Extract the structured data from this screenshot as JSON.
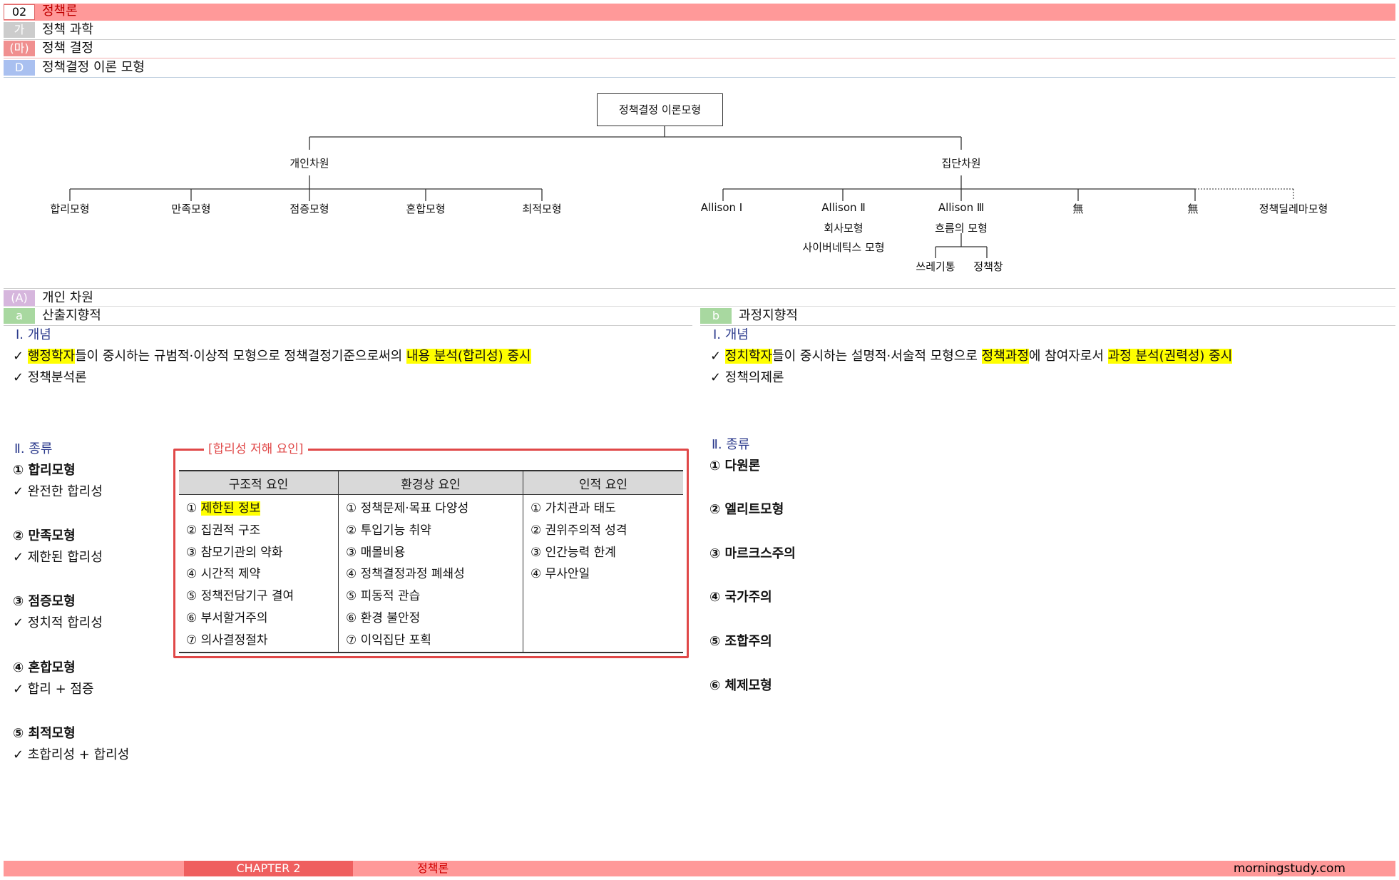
{
  "header": {
    "row1": {
      "num": "02",
      "title": "정책론"
    },
    "row2": {
      "tag": "가",
      "title": "정책 과학"
    },
    "row3": {
      "tag": "(마)",
      "title": "정책 결정"
    },
    "row4": {
      "tag": "D",
      "title": "정책결정 이론 모형"
    }
  },
  "tree": {
    "root": "정책결정 이론모형",
    "individual": "개인차원",
    "group": "집단차원",
    "ind_leaves": [
      "합리모형",
      "만족모형",
      "점증모형",
      "혼합모형",
      "최적모형"
    ],
    "allison1": "Allison Ⅰ",
    "allison2": "Allison Ⅱ",
    "allison2_sub1": "회사모형",
    "allison2_sub2": "사이버네틱스 모형",
    "allison3": "Allison Ⅲ",
    "allison3_sub": "흐름의 모형",
    "trash": "쓰레기통",
    "window": "정책창",
    "none1": "無",
    "none2": "無",
    "dilemma": "정책딜레마모형"
  },
  "sectionA": {
    "tag": "(A)",
    "title": "개인 차원"
  },
  "left": {
    "sub_tag": "a",
    "sub_title": "산출지향적",
    "concept_heading": "Ⅰ. 개념",
    "concept_l1": {
      "check": "✓",
      "hl1": "행정학자",
      "mid": "들이 중시하는 규범적·이상적 모형으로 정책결정기준으로써의 ",
      "hl2": "내용 분석(합리성) 중시"
    },
    "concept_l2": "✓ 정책분석론",
    "kinds_heading": "Ⅱ. 종류",
    "kinds": [
      {
        "title": "① 합리모형",
        "desc": "✓ 완전한 합리성"
      },
      {
        "title": "② 만족모형",
        "desc": "✓ 제한된 합리성"
      },
      {
        "title": "③ 점증모형",
        "desc": "✓ 정치적 합리성"
      },
      {
        "title": "④ 혼합모형",
        "desc": "✓ 합리 + 점증"
      },
      {
        "title": "⑤ 최적모형",
        "desc": "✓ 초합리성 + 합리성"
      }
    ]
  },
  "factors": {
    "title": "[합리성 저해 요인]",
    "headers": [
      "구조적 요인",
      "환경상 요인",
      "인적 요인"
    ],
    "first_pre": "① ",
    "first_hl": "제한된 정보",
    "structural_rest": [
      "② 집권적 구조",
      "③ 참모기관의 약화",
      "④ 시간적 제약",
      "⑤ 정책전담기구 결여",
      "⑥ 부서할거주의",
      "⑦ 의사결정절차"
    ],
    "environmental": [
      "① 정책문제·목표 다양성",
      "② 투입기능 취약",
      "③ 매몰비용",
      "④ 정책결정과정 폐쇄성",
      "⑤ 피동적 관습",
      "⑥ 환경 불안정",
      "⑦ 이익집단 포획"
    ],
    "human": [
      "① 가치관과 태도",
      "② 권위주의적 성격",
      "③ 인간능력 한계",
      "④ 무사안일"
    ]
  },
  "right": {
    "sub_tag": "b",
    "sub_title": "과정지향적",
    "concept_heading": "Ⅰ. 개념",
    "concept_l1": {
      "check": "✓",
      "hl1": "정치학자",
      "mid1": "들이 중시하는 설명적·서술적 모형으로 ",
      "hl2": "정책과정",
      "mid2": "에 참여자로서 ",
      "hl3": "과정 분석(권력성) 중시"
    },
    "concept_l2": "✓ 정책의제론",
    "kinds_heading": "Ⅱ. 종류",
    "kinds": [
      "① 다원론",
      "② 엘리트모형",
      "③ 마르크스주의",
      "④ 국가주의",
      "⑤ 조합주의",
      "⑥ 체제모형"
    ]
  },
  "footer": {
    "chapter": "CHAPTER 2",
    "title": "정책론",
    "site": "morningstudy.com"
  },
  "colors": {
    "pink": "#ff9999",
    "chapter": "#ef5f5f",
    "gray_tag": "#cccccc",
    "pink_tag": "#f08f8f",
    "blue_tag": "#a9c0f0",
    "purple_tag": "#d6b6dd",
    "green_tag": "#a8d8a0",
    "red_box": "#e04848",
    "highlight": "#ffff00"
  }
}
